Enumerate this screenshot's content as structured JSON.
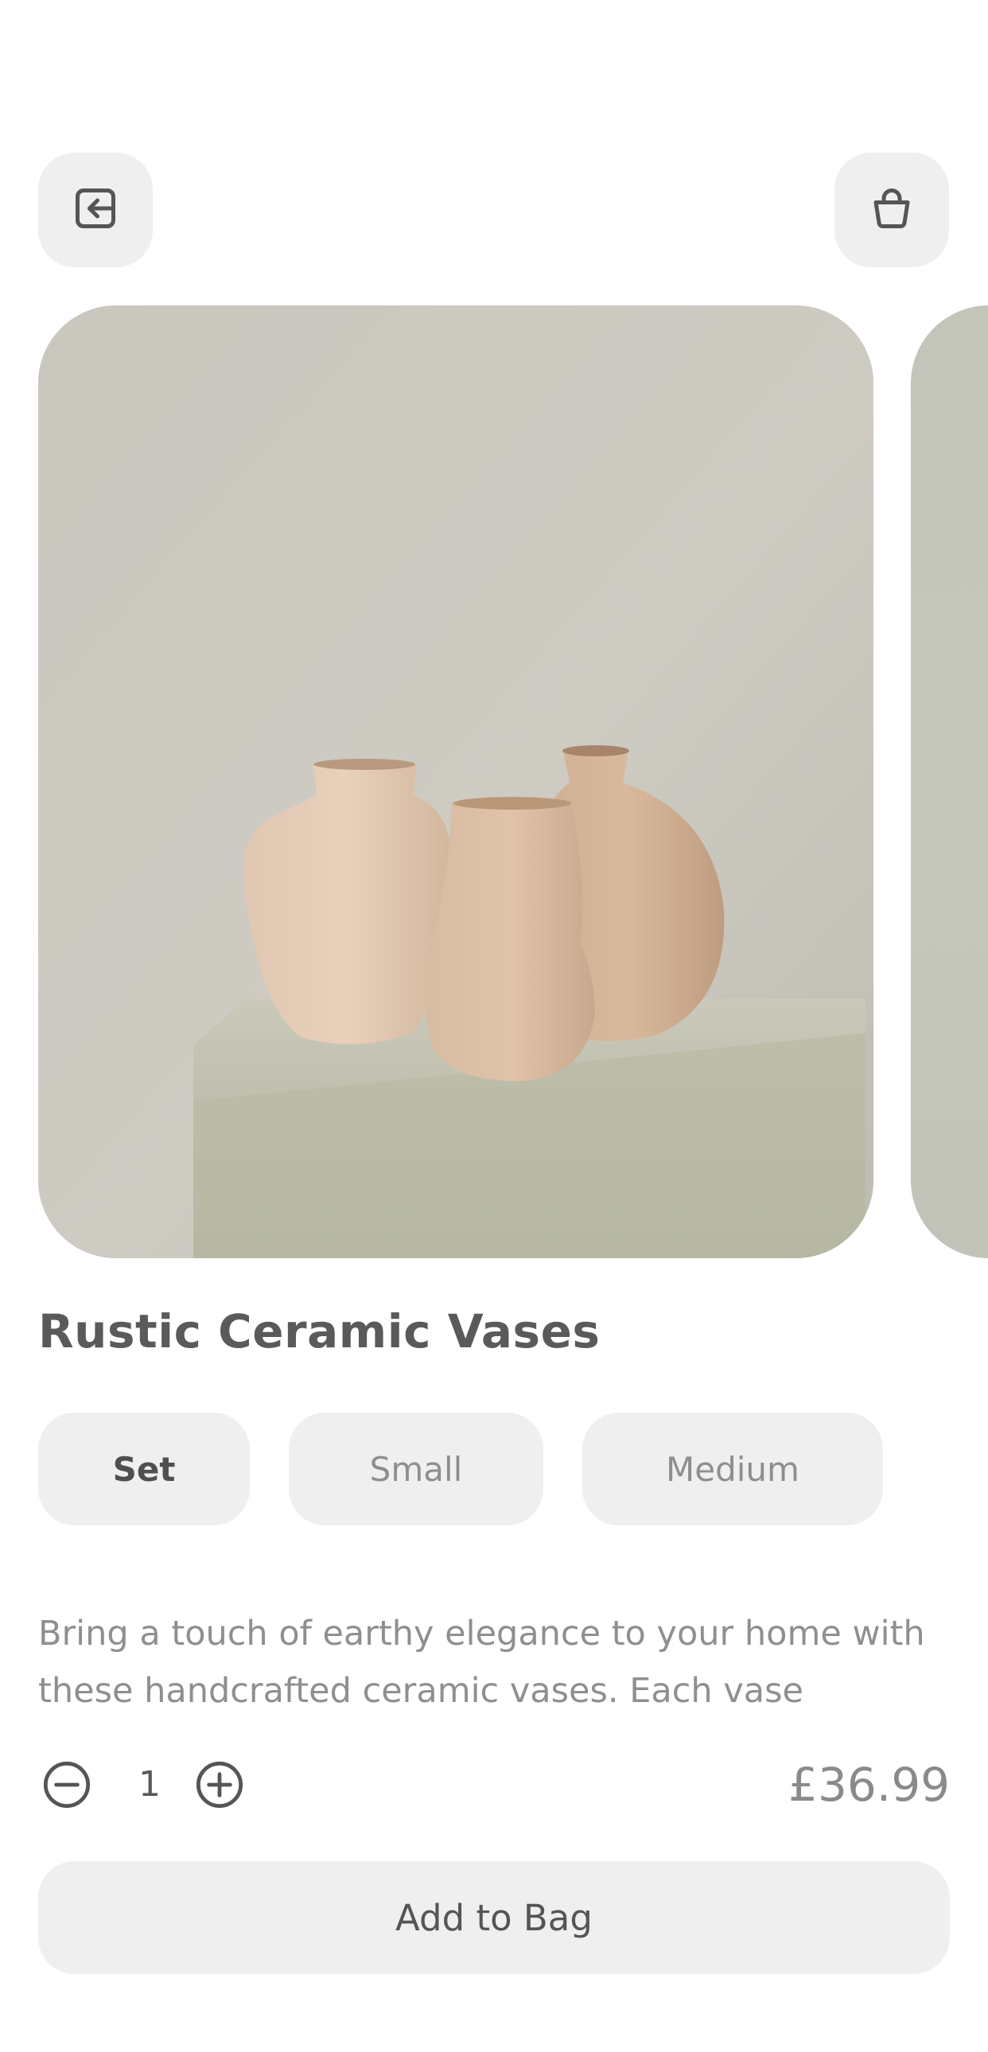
{
  "header": {
    "back_icon": "exit-arrow-icon",
    "bag_icon": "shopping-bag-icon"
  },
  "product": {
    "title": "Rustic Ceramic Vases",
    "image_alt": "Three handmade ceramic vases on a plaster pedestal",
    "variants": [
      {
        "label": "Set",
        "selected": true
      },
      {
        "label": "Small",
        "selected": false
      },
      {
        "label": "Medium",
        "selected": false
      }
    ],
    "description": "Bring a touch of earthy elegance to your home with these handcrafted ceramic vases. Each vase",
    "quantity": "1",
    "price": "£36.99"
  },
  "actions": {
    "add_to_bag_label": "Add to Bag"
  },
  "colors": {
    "button_bg": "#efefef",
    "text_primary": "#5a5a5a",
    "text_secondary": "#8f8f8f"
  }
}
